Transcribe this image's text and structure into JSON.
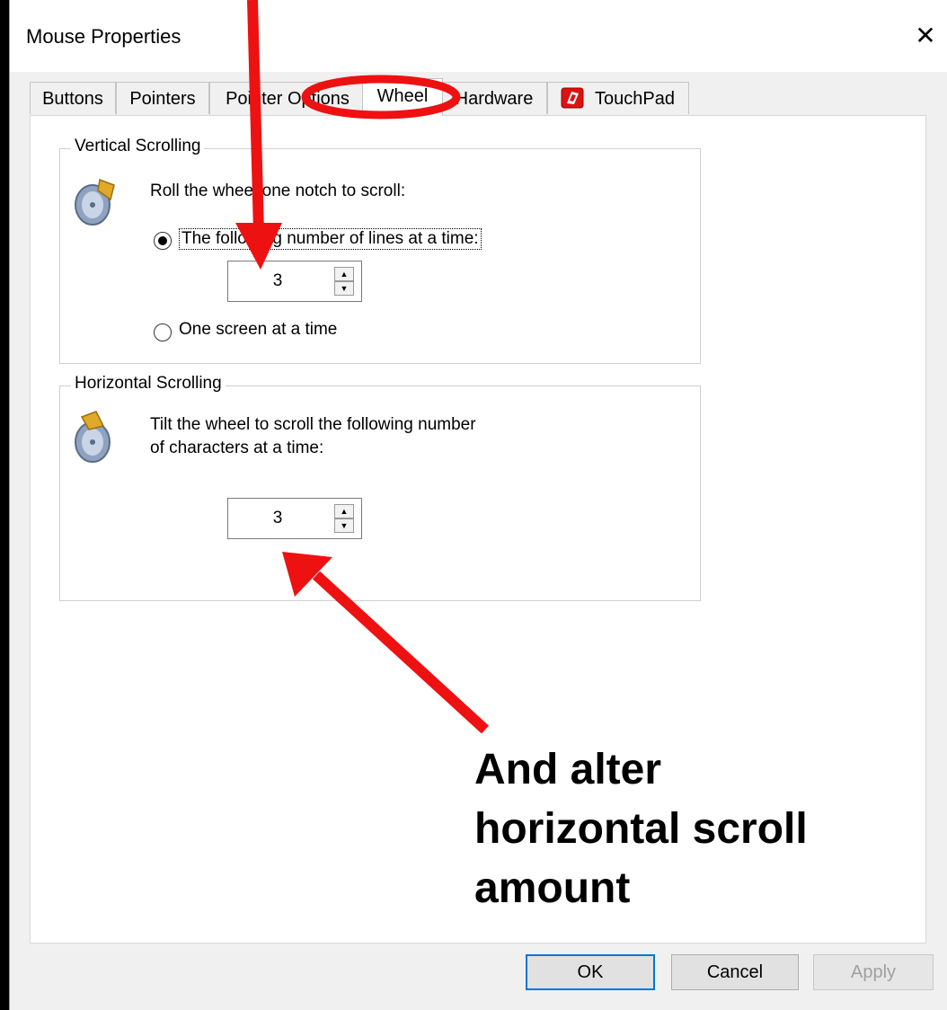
{
  "window": {
    "title": "Mouse Properties",
    "close_glyph": "✕"
  },
  "tabs": [
    {
      "label": "Buttons"
    },
    {
      "label": "Pointers"
    },
    {
      "label": "Pointer Options"
    },
    {
      "label": "Wheel",
      "active": true
    },
    {
      "label": "Hardware"
    },
    {
      "label": "TouchPad"
    }
  ],
  "vertical": {
    "legend": "Vertical Scrolling",
    "instruction": "Roll the wheel one notch to scroll:",
    "option_lines": "The following number of lines at a time:",
    "option_lines_checked": true,
    "lines_value": "3",
    "option_screen": "One screen at a time",
    "option_screen_checked": false
  },
  "horizontal": {
    "legend": "Horizontal Scrolling",
    "instruction_line1": "Tilt the wheel to scroll the following number",
    "instruction_line2": "of characters at a time:",
    "chars_value": "3"
  },
  "buttons": {
    "ok": "OK",
    "cancel": "Cancel",
    "apply": "Apply"
  },
  "annotation": {
    "caption_line1": "And alter",
    "caption_line2": "horizontal scroll",
    "caption_line3": "amount",
    "color": "#ee1111"
  },
  "icons": {
    "wheel": "mouse-wheel-icon",
    "touchpad": "touchpad-icon",
    "close": "close-icon",
    "spin_up": "spin-up-icon",
    "spin_down": "spin-down-icon"
  }
}
